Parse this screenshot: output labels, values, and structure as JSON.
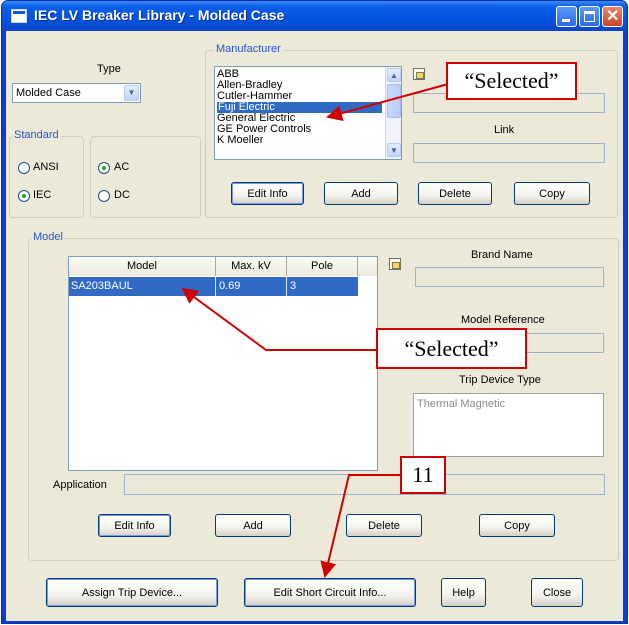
{
  "window": {
    "title": "IEC LV Breaker Library - Molded Case"
  },
  "type": {
    "label": "Type",
    "selected": "Molded Case"
  },
  "standard": {
    "label": "Standard",
    "ansi": "ANSI",
    "iec": "IEC",
    "ac": "AC",
    "dc": "DC",
    "selected_standard": "IEC",
    "selected_current": "AC"
  },
  "manufacturer": {
    "label": "Manufacturer",
    "items": [
      "ABB",
      "Allen-Bradley",
      "Cutler-Hammer",
      "Fuji Electric",
      "General Electric",
      "GE Power Controls",
      "K Moeller"
    ],
    "selected": "Fuji Electric",
    "link_label": "Link",
    "buttons": {
      "edit_info": "Edit Info",
      "add": "Add",
      "delete": "Delete",
      "copy": "Copy"
    }
  },
  "model": {
    "label": "Model",
    "columns": [
      "Model",
      "Max. kV",
      "Pole"
    ],
    "rows": [
      {
        "model": "SA203BAUL",
        "max_kv": "0.69",
        "pole": "3"
      }
    ],
    "brand_name_label": "Brand Name",
    "model_reference_label": "Model Reference",
    "trip_device_type_label": "Trip Device Type",
    "trip_device_type_value": "Thermal Magnetic",
    "application_label": "Application",
    "buttons": {
      "edit_info": "Edit Info",
      "add": "Add",
      "delete": "Delete",
      "copy": "Copy"
    }
  },
  "footer": {
    "assign_trip_device": "Assign Trip Device...",
    "edit_short_circuit_info": "Edit Short Circuit Info...",
    "help": "Help",
    "close": "Close"
  },
  "annotations": {
    "callout_manufacturer": "“Selected”",
    "callout_model": "“Selected”",
    "callout_number": "11",
    "arrow_color": "#d00000"
  },
  "colors": {
    "titlebar": "#0553e0",
    "selection": "#316ac5",
    "group_label": "#2256d6",
    "dialog_bg": "#ece9d8"
  }
}
